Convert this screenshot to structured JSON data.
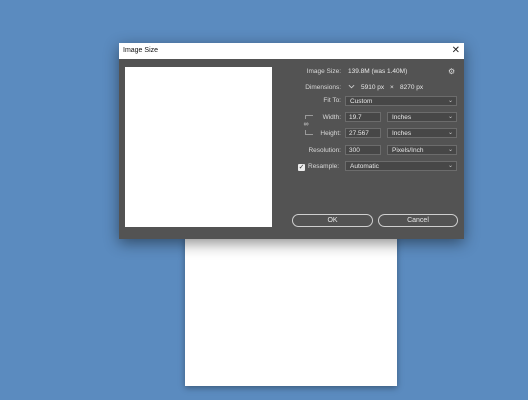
{
  "dialog": {
    "title": "Image Size",
    "close_glyph": "✕",
    "image_size_label": "Image Size:",
    "image_size_value": "139.8M (was 1.40M)",
    "gear_icon": "gear-icon",
    "dimensions_label": "Dimensions:",
    "dimensions_width": "5910 px",
    "dimensions_times": "×",
    "dimensions_height": "8270 px",
    "fit_to_label": "Fit To:",
    "fit_to_value": "Custom",
    "width_label": "Width:",
    "width_value": "19.7",
    "width_unit": "Inches",
    "height_label": "Height:",
    "height_value": "27.567",
    "height_unit": "Inches",
    "resolution_label": "Resolution:",
    "resolution_value": "300",
    "resolution_unit": "Pixels/Inch",
    "resample_label": "Resample:",
    "resample_checked": true,
    "resample_value": "Automatic",
    "ok_label": "OK",
    "cancel_label": "Cancel"
  },
  "colors": {
    "background": "#5b8bbf",
    "dialog": "#535353",
    "field": "#474747"
  }
}
